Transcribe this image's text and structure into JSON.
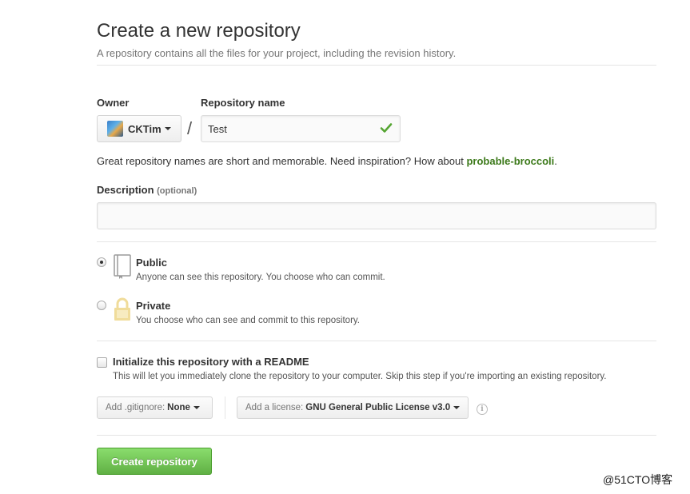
{
  "header": {
    "title": "Create a new repository",
    "subtitle": "A repository contains all the files for your project, including the revision history."
  },
  "owner": {
    "label": "Owner",
    "value": "CKTim"
  },
  "separator": "/",
  "repo_name": {
    "label": "Repository name",
    "value": "Test"
  },
  "hint": {
    "prefix": "Great repository names are short and memorable. Need inspiration? How about ",
    "suggestion": "probable-broccoli",
    "suffix": "."
  },
  "description": {
    "label": "Description",
    "optional": "(optional)",
    "value": ""
  },
  "visibility": {
    "public": {
      "title": "Public",
      "desc": "Anyone can see this repository. You choose who can commit.",
      "selected": true
    },
    "private": {
      "title": "Private",
      "desc": "You choose who can see and commit to this repository.",
      "selected": false
    }
  },
  "readme": {
    "label": "Initialize this repository with a README",
    "desc": "This will let you immediately clone the repository to your computer. Skip this step if you're importing an existing repository.",
    "checked": false
  },
  "gitignore": {
    "prefix": "Add .gitignore:",
    "value": "None"
  },
  "license": {
    "prefix": "Add a license:",
    "value": "GNU General Public License v3.0"
  },
  "info_icon_glyph": "i",
  "submit_label": "Create repository",
  "watermark": "@51CTO博客",
  "colors": {
    "accent_green": "#60b044",
    "suggestion_green": "#3d7a1b",
    "check_green": "#55a532",
    "private_lock": "#f0dc9a"
  }
}
